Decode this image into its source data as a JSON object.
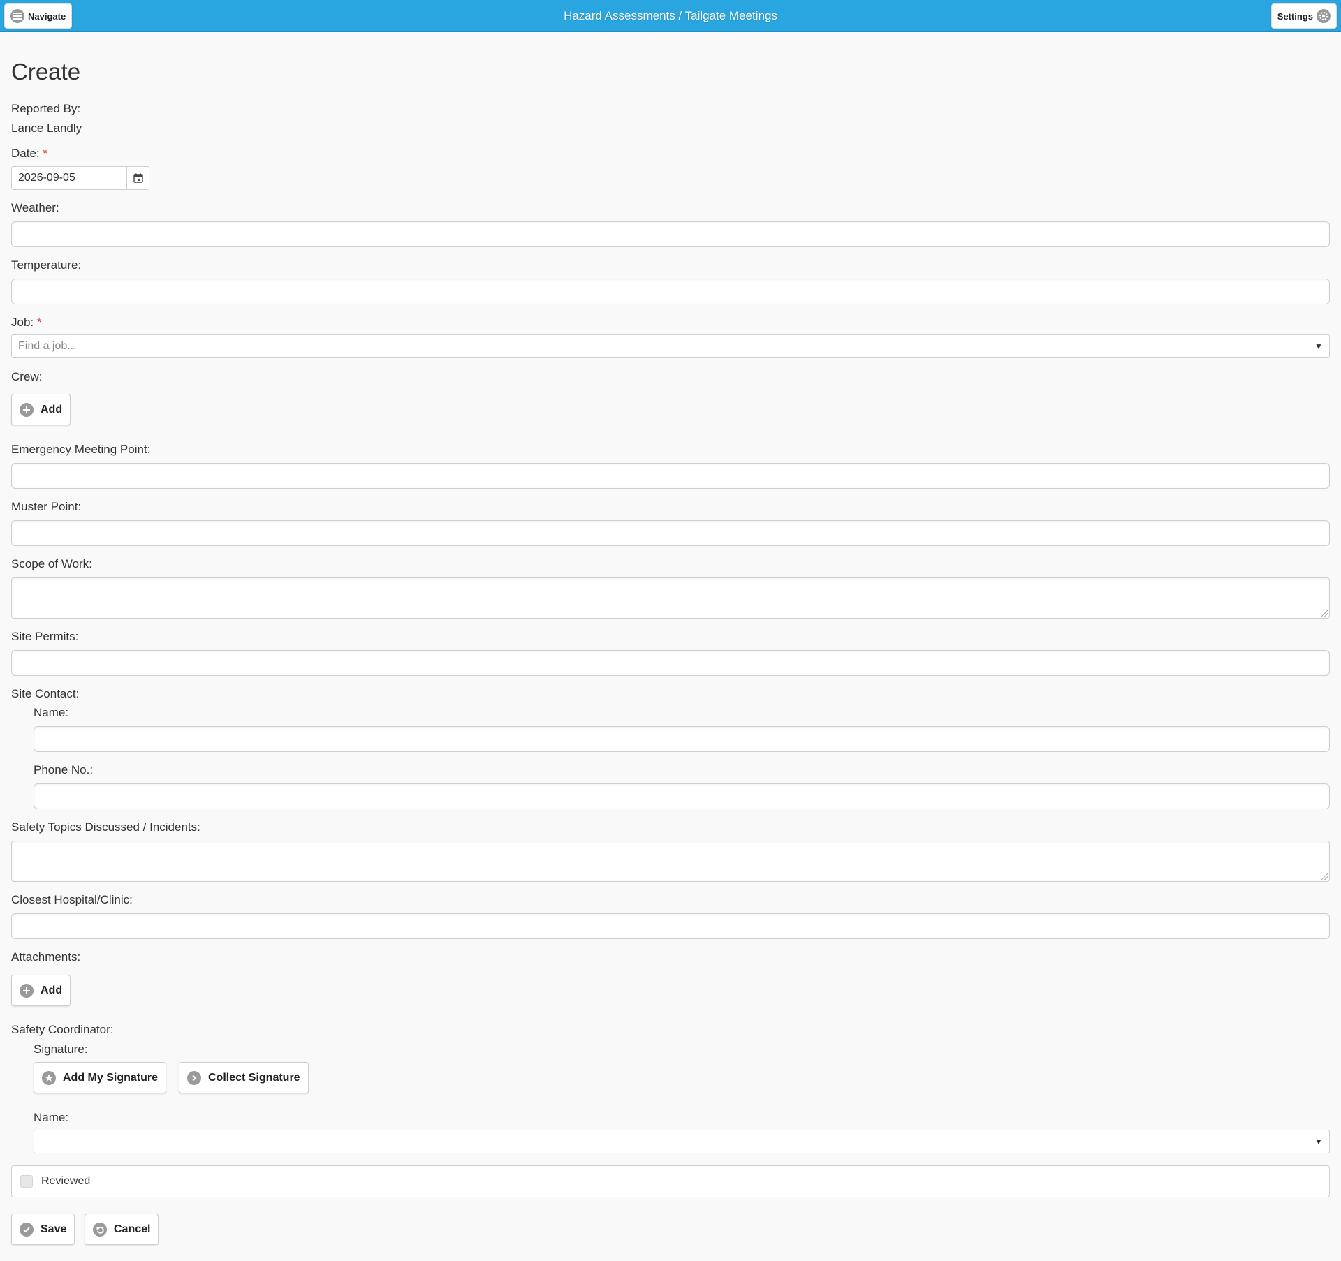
{
  "header": {
    "title": "Hazard Assessments / Tailgate Meetings",
    "navigate_label": "Navigate",
    "settings_label": "Settings"
  },
  "page": {
    "title": "Create"
  },
  "reported_by": {
    "label": "Reported By:",
    "value": "Lance Landly"
  },
  "date": {
    "label": "Date:",
    "required_mark": "*",
    "value": "2026-09-05"
  },
  "weather": {
    "label": "Weather:"
  },
  "temperature": {
    "label": "Temperature:"
  },
  "job": {
    "label": "Job:",
    "required_mark": "*",
    "placeholder": "Find a job..."
  },
  "crew": {
    "label": "Crew:",
    "add_label": "Add"
  },
  "emergency_meeting_point": {
    "label": "Emergency Meeting Point:"
  },
  "muster_point": {
    "label": "Muster Point:"
  },
  "scope_of_work": {
    "label": "Scope of Work:"
  },
  "site_permits": {
    "label": "Site Permits:"
  },
  "site_contact": {
    "label": "Site Contact:",
    "name_label": "Name:",
    "phone_label": "Phone No.:"
  },
  "safety_topics": {
    "label": "Safety Topics Discussed / Incidents:"
  },
  "closest_hospital": {
    "label": "Closest Hospital/Clinic:"
  },
  "attachments": {
    "label": "Attachments:",
    "add_label": "Add"
  },
  "safety_coordinator": {
    "label": "Safety Coordinator:",
    "signature_label": "Signature:",
    "add_my_signature_label": "Add My Signature",
    "collect_signature_label": "Collect Signature",
    "name_label": "Name:"
  },
  "reviewed": {
    "label": "Reviewed"
  },
  "actions": {
    "save_label": "Save",
    "cancel_label": "Cancel"
  },
  "colors": {
    "header": "#29a6e0",
    "required": "#e03030",
    "icon_gray": "#9a9a9a"
  },
  "icons": {
    "navigate": "bars-icon",
    "settings": "gear-icon",
    "calendar": "calendar-icon",
    "add": "plus-circle-icon",
    "add_signature": "star-icon",
    "collect_signature": "chevron-right-icon",
    "save": "check-icon",
    "cancel": "undo-icon",
    "dropdown": "caret-down-icon"
  }
}
